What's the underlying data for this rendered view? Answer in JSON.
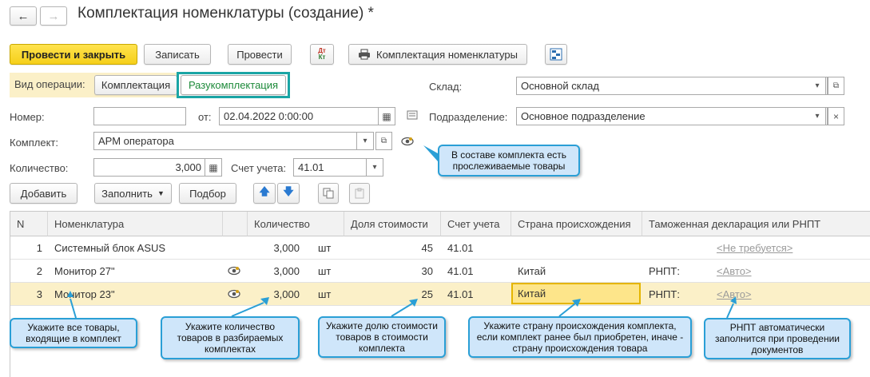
{
  "window": {
    "title": "Комплектация номенклатуры (создание) *"
  },
  "toolbar": {
    "post_close": "Провести и закрыть",
    "save": "Записать",
    "post": "Провести",
    "dtkt": "Дт Кт",
    "print_label": "Комплектация номенклатуры"
  },
  "form": {
    "op_label": "Вид операции:",
    "op_option1": "Комплектация",
    "op_option2": "Разукомплектация",
    "warehouse_label": "Склад:",
    "warehouse_value": "Основной склад",
    "number_label": "Номер:",
    "number_value": "",
    "date_label": "от:",
    "date_value": "02.04.2022  0:00:00",
    "department_label": "Подразделение:",
    "department_value": "Основное подразделение",
    "kit_label": "Комплект:",
    "kit_value": "АРМ оператора",
    "quantity_label": "Количество:",
    "quantity_value": "3,000",
    "account_label": "Счет учета:",
    "account_value": "41.01"
  },
  "table_toolbar": {
    "add": "Добавить",
    "fill": "Заполнить",
    "select": "Подбор"
  },
  "table": {
    "columns": [
      "N",
      "Номенклатура",
      "Количество",
      "Доля стоимости",
      "Счет учета",
      "Страна происхождения",
      "Таможенная декларация или РНПТ"
    ],
    "rows": [
      {
        "n": "1",
        "item": "Системный блок ASUS",
        "qty": "3,000",
        "unit": "шт",
        "share": "45",
        "account": "41.01",
        "country": "",
        "decl_prefix": "",
        "decl": "<Не требуется>"
      },
      {
        "n": "2",
        "item": "Монитор 27\"",
        "qty": "3,000",
        "unit": "шт",
        "share": "30",
        "account": "41.01",
        "country": "Китай",
        "decl_prefix": "РНПТ:",
        "decl": "<Авто>"
      },
      {
        "n": "3",
        "item": "Монитор 23\"",
        "qty": "3,000",
        "unit": "шт",
        "share": "25",
        "account": "41.01",
        "country": "Китай",
        "decl_prefix": "РНПТ:",
        "decl": "<Авто>"
      }
    ]
  },
  "callouts": {
    "traceable": "В составе комплекта есть прослеживаемые товары",
    "items": "Укажите все товары, входящие в комплект",
    "qty": "Укажите количество товаров в разбираемых комплектах",
    "share": "Укажите долю стоимости товаров в стоимости комплекта",
    "country": "Укажите страну происхождения комплекта, если комплект ранее был приобретен, иначе - страну происхождения товара",
    "rnpt": "РНПТ автоматически заполнится при проведении документов"
  },
  "colors": {
    "accent": "#2a9fd6",
    "primary_button": "#f5cf1a",
    "selected_row": "#fbf0c8",
    "op_selected_border": "#1aa5a5"
  }
}
